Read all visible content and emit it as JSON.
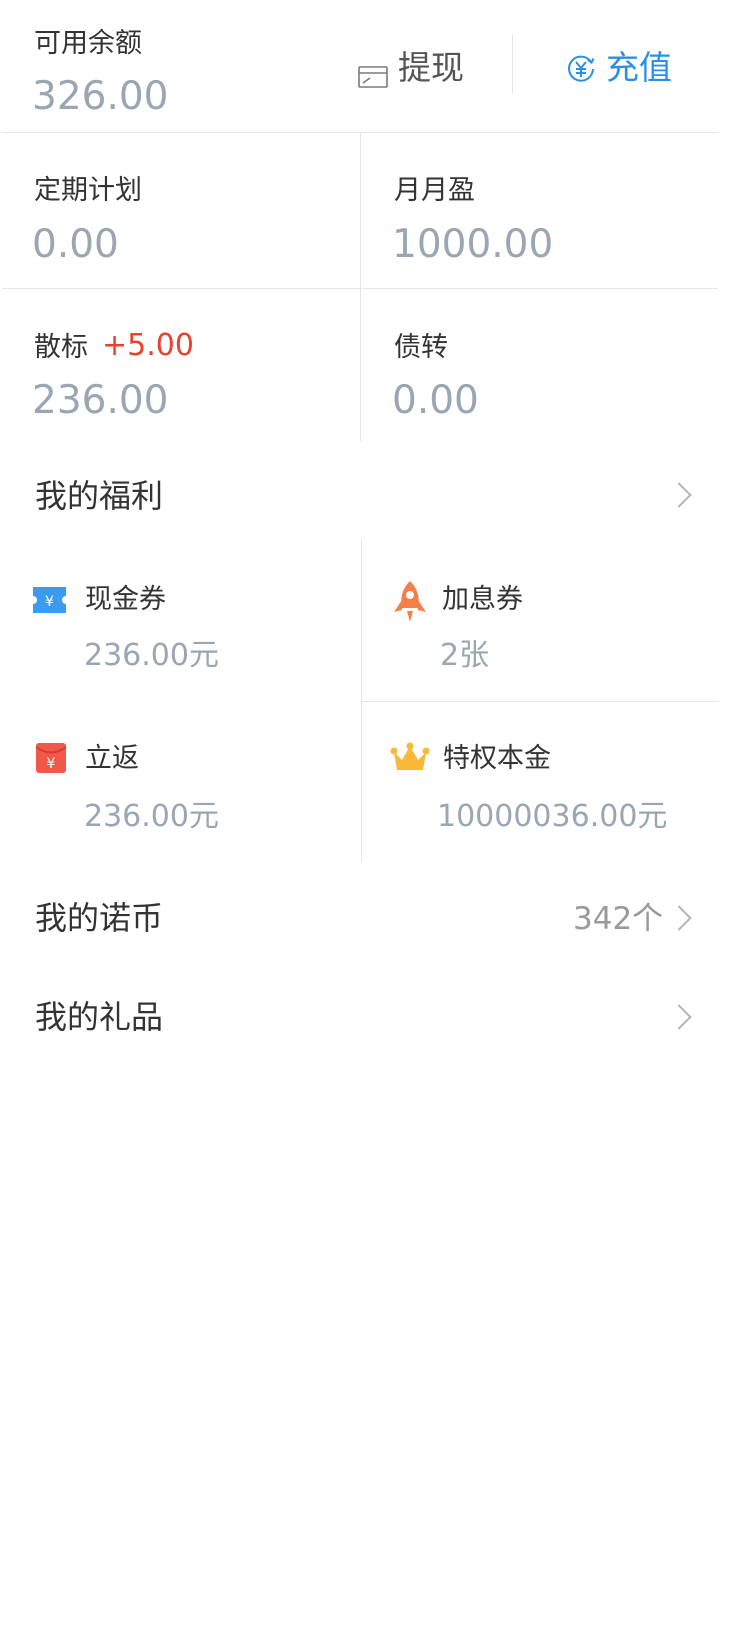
{
  "balance": {
    "label": "可用余额",
    "value": "326.00"
  },
  "actions": {
    "withdraw_label": "提现",
    "recharge_label": "充值",
    "recharge_color": "#2a8fe8",
    "withdraw_color": "#555555"
  },
  "assets": {
    "regular": {
      "label": "定期计划",
      "value": "0.00"
    },
    "monthly": {
      "label": "月月盈",
      "value": "1000.00"
    },
    "loose": {
      "label": "散标",
      "delta": "+5.00",
      "value": "236.00",
      "delta_color": "#e8412e"
    },
    "transfer": {
      "label": "债转",
      "value": "0.00"
    }
  },
  "welfare": {
    "title": "我的福利",
    "cash_coupon": {
      "label": "现金券",
      "value": "236.00元",
      "icon": "ticket-icon"
    },
    "interest_coupon": {
      "label": "加息券",
      "value": "2张",
      "icon": "rocket-icon"
    },
    "rebate": {
      "label": "立返",
      "value": "236.00元",
      "icon": "red-envelope-icon"
    },
    "privilege": {
      "label": "特权本金",
      "value": "10000036.00元",
      "icon": "crown-icon"
    }
  },
  "coins": {
    "title": "我的诺币",
    "count": "342个"
  },
  "gifts": {
    "title": "我的礼品"
  }
}
